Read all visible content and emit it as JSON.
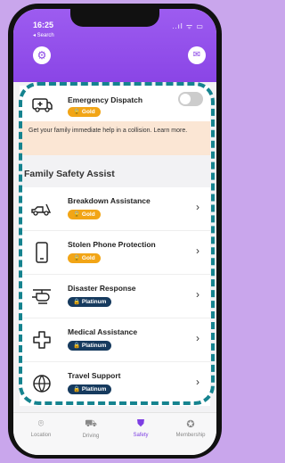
{
  "status_bar": {
    "time": "16:25",
    "back_label": "◂ Search",
    "signal_icons": "..ıl ᯤ ▭"
  },
  "header": {
    "settings_icon": "gear-icon",
    "mail_icon": "mail-icon"
  },
  "emergency": {
    "title": "Emergency Dispatch",
    "badge": "Gold",
    "toggle_on": false,
    "description": "Get your family immediate help in a collision. Learn more."
  },
  "section": {
    "title": "Family Safety Assist"
  },
  "features": [
    {
      "title": "Breakdown Assistance",
      "badge": "Gold",
      "tier": "gold",
      "icon": "tow-truck-icon"
    },
    {
      "title": "Stolen Phone Protection",
      "badge": "Gold",
      "tier": "gold",
      "icon": "phone-icon"
    },
    {
      "title": "Disaster Response",
      "badge": "Platinum",
      "tier": "platinum",
      "icon": "helicopter-icon"
    },
    {
      "title": "Medical Assistance",
      "badge": "Platinum",
      "tier": "platinum",
      "icon": "medical-cross-icon"
    },
    {
      "title": "Travel Support",
      "badge": "Platinum",
      "tier": "platinum",
      "icon": "globe-icon"
    }
  ],
  "tabs": [
    {
      "label": "Location",
      "icon": "location-pin-icon",
      "active": false
    },
    {
      "label": "Driving",
      "icon": "car-icon",
      "active": false
    },
    {
      "label": "Safety",
      "icon": "shield-icon",
      "active": true
    },
    {
      "label": "Membership",
      "icon": "membership-badge-icon",
      "active": false
    }
  ],
  "colors": {
    "brand": "#8a45e6",
    "gold": "#f2a516",
    "platinum": "#163a5e",
    "highlight": "#15838f"
  }
}
